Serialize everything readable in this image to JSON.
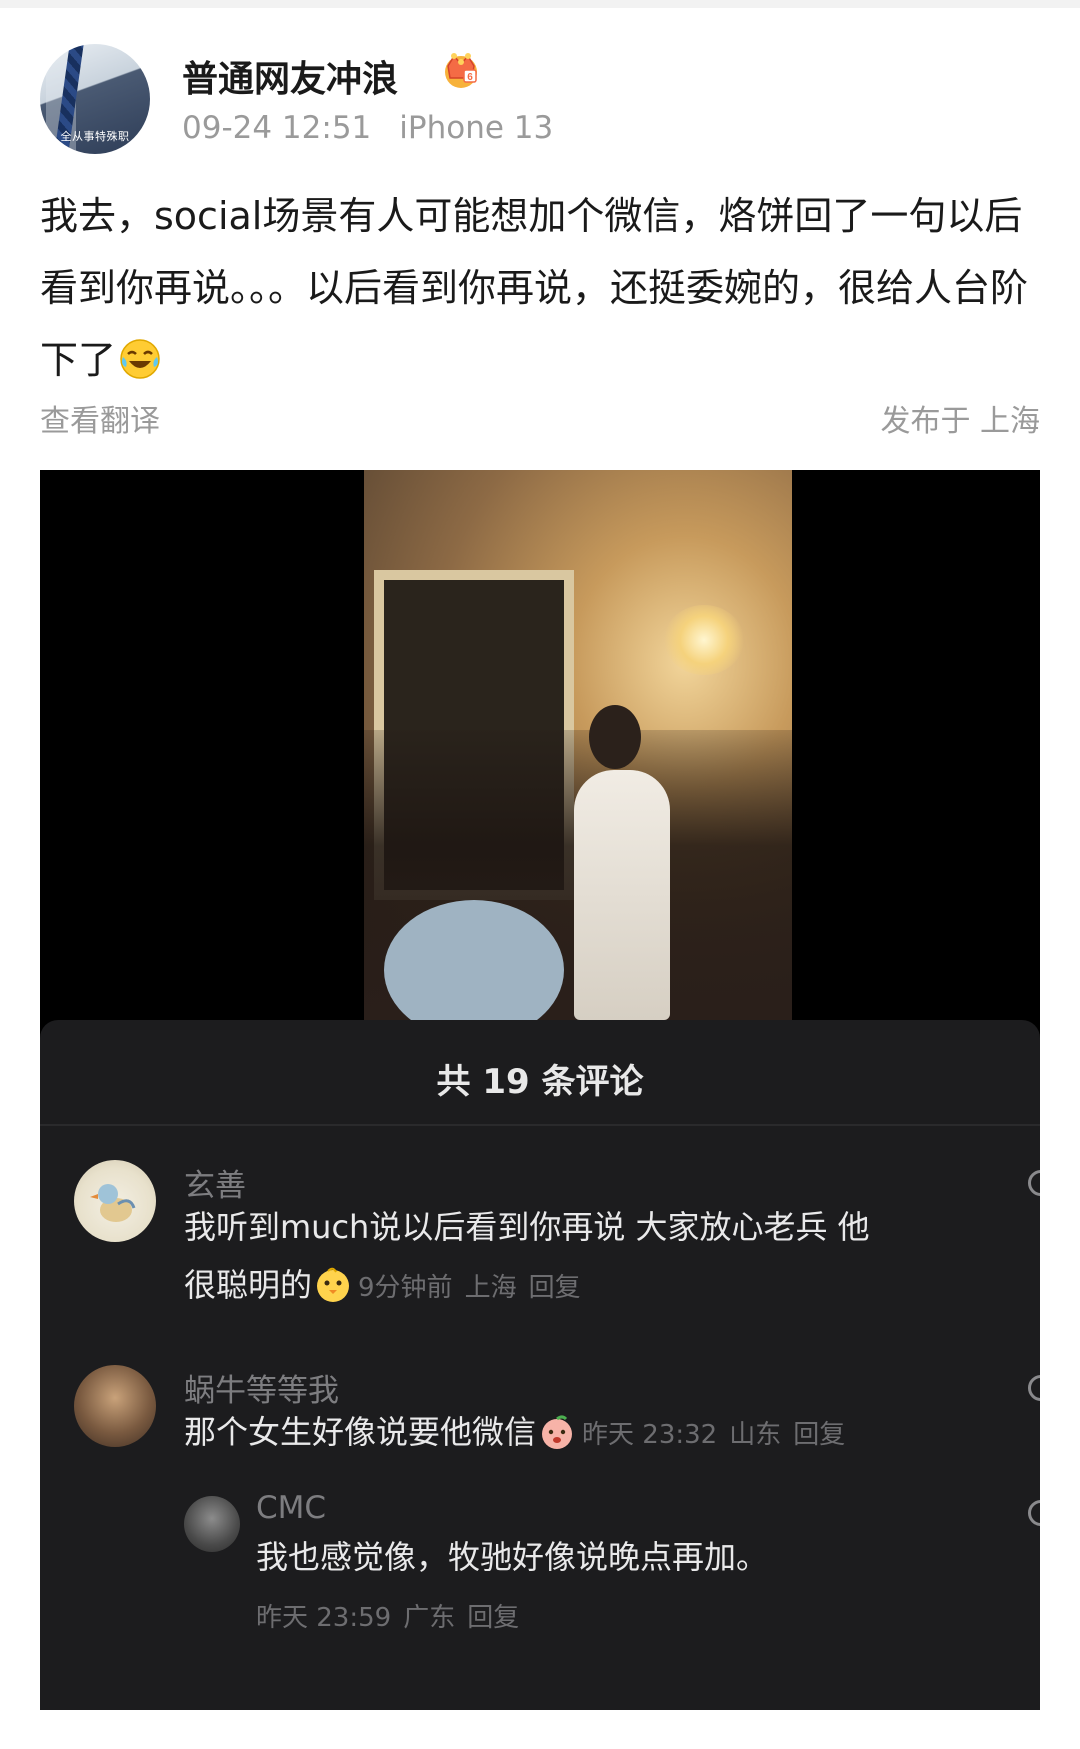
{
  "post": {
    "username": "普通网友冲浪",
    "timestamp": "09-24 12:51",
    "device": "iPhone 13",
    "avatar_caption": "全从事特殊职",
    "text_before_emoji": "我去，social场景有人可能想加个微信，烙饼回了一句以后看到你再说。。。以后看到你再说，还挺委婉的，很给人台阶下了",
    "translate_label": "查看翻译",
    "location_label": "发布于 上海",
    "badge_icon": "crown-badge-icon",
    "end_emoji": "laugh-cry-emoji"
  },
  "embedded_screenshot": {
    "panel_title": "共 19 条评论",
    "comments": [
      {
        "name": "玄善",
        "text": "我听到much说以后看到你再说 大家放心老兵 他很聪明的",
        "emoji": "chick-emoji",
        "time": "9分钟前",
        "location": "上海",
        "reply_label": "回复"
      },
      {
        "name": "蜗牛等等我",
        "text": "那个女生好像说要他微信",
        "emoji": "peach-face-emoji",
        "time": "昨天 23:32",
        "location": "山东",
        "reply_label": "回复"
      },
      {
        "name": "CMC",
        "text": "我也感觉像，牧驰好像说晚点再加。",
        "time": "昨天 23:59",
        "location": "广东",
        "reply_label": "回复"
      }
    ]
  },
  "colors": {
    "text_primary": "#1a1a1a",
    "text_secondary": "#9a9a9a",
    "panel_bg": "#1c1c1e"
  }
}
